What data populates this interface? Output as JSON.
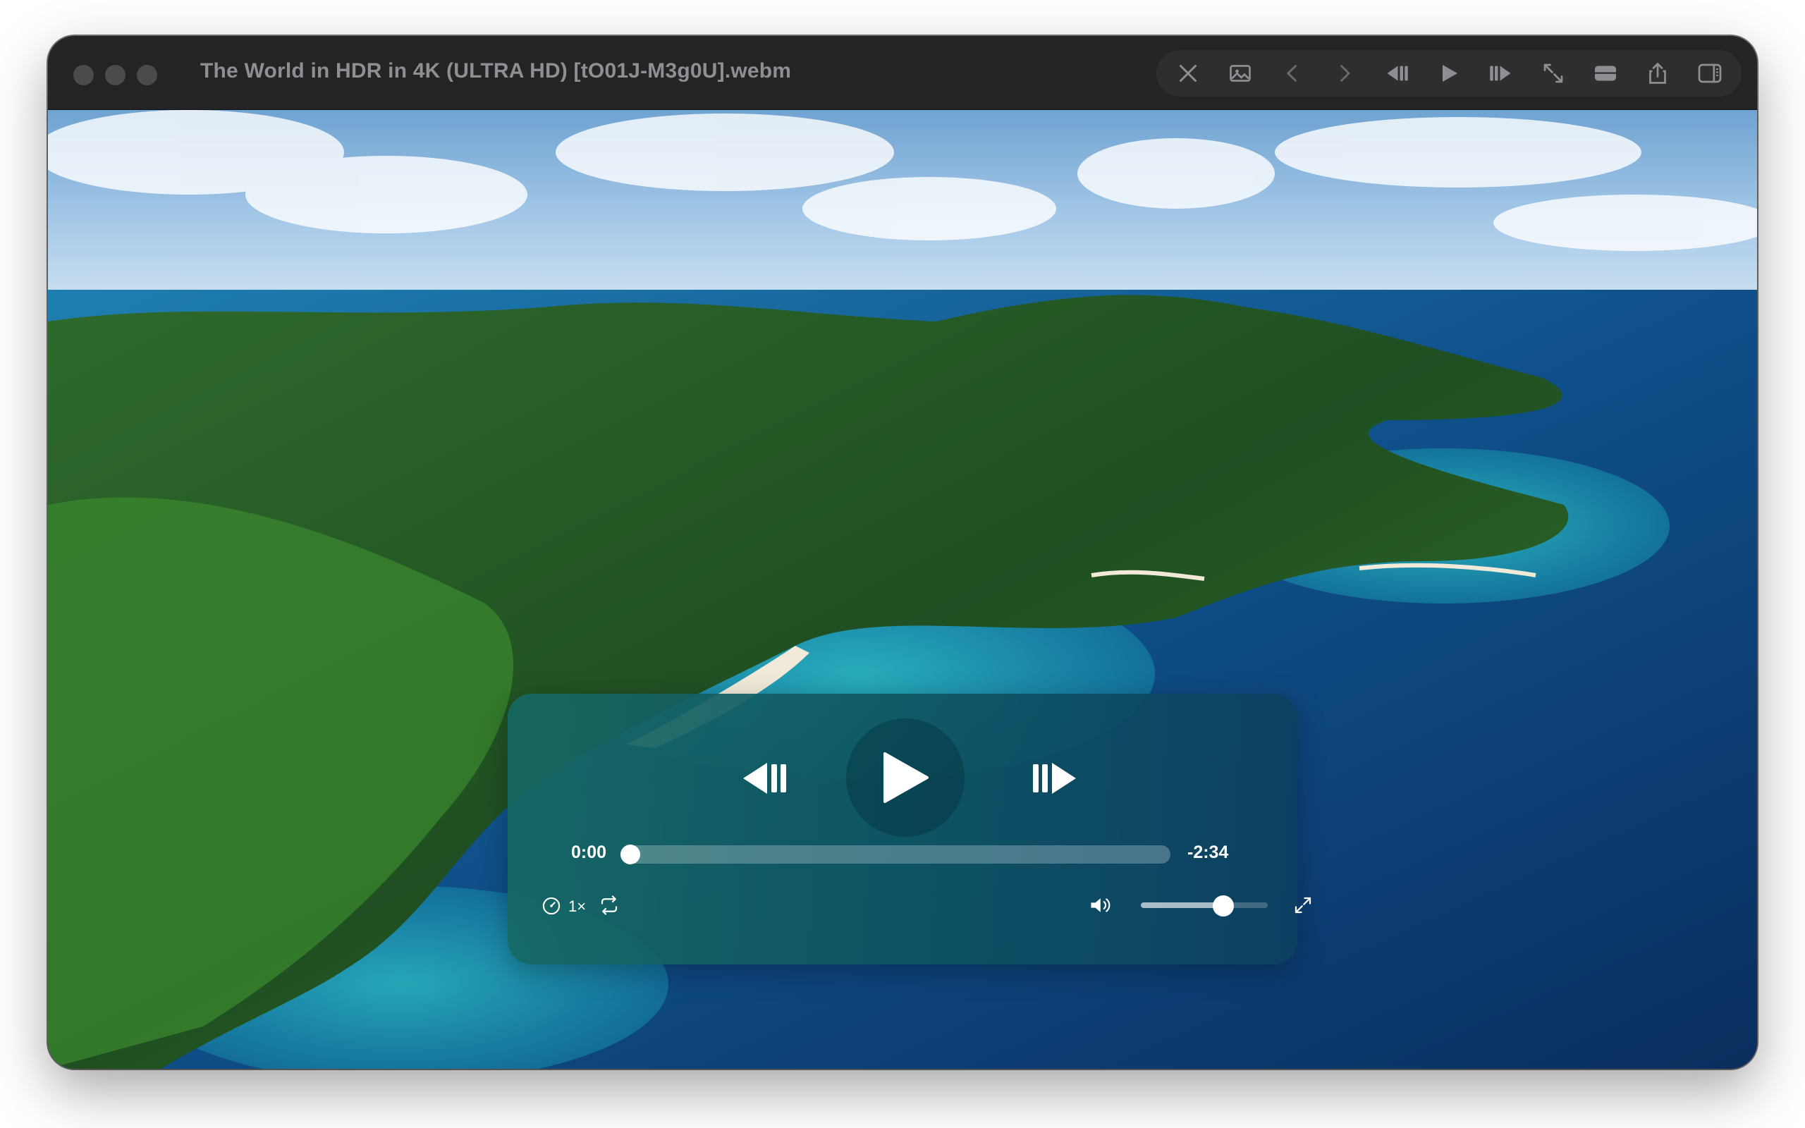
{
  "window": {
    "title": "The World in HDR in 4K (ULTRA HD) [tO01J-M3g0U].webm"
  },
  "toolbar": {
    "buttons": [
      {
        "name": "close-icon"
      },
      {
        "name": "image-icon"
      },
      {
        "name": "chevron-left-icon"
      },
      {
        "name": "chevron-right-icon"
      },
      {
        "name": "skip-back-icon"
      },
      {
        "name": "play-icon"
      },
      {
        "name": "skip-forward-icon"
      },
      {
        "name": "resize-icon"
      },
      {
        "name": "panel-bottom-icon"
      },
      {
        "name": "share-icon"
      },
      {
        "name": "sidebar-icon"
      }
    ]
  },
  "player": {
    "current_time": "0:00",
    "remaining_time": "-2:34",
    "progress": 0.0,
    "speed_label": "1×",
    "volume": 0.65
  },
  "colors": {
    "titlebar": "#242426",
    "toolbar_pill": "#2e2e30",
    "title_text": "#8e8e93",
    "hud_start": "#166862",
    "hud_end": "#0c4060"
  }
}
